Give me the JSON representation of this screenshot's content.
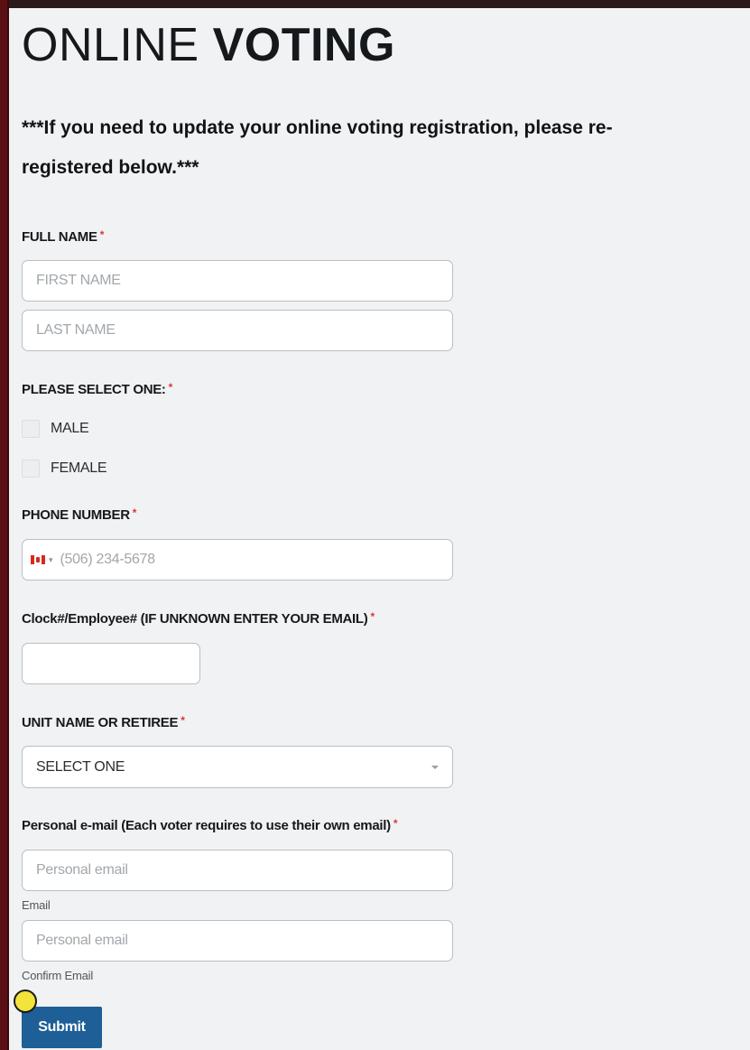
{
  "page": {
    "title_light": "ONLINE",
    "title_bold": "VOTING",
    "notice": "***If you need to update your online voting registration, please re-registered below.***"
  },
  "form": {
    "required_mark": "*",
    "full_name": {
      "label": "FULL NAME",
      "first_placeholder": "FIRST NAME",
      "last_placeholder": "LAST NAME"
    },
    "gender": {
      "label": "PLEASE SELECT ONE:",
      "options": [
        "MALE",
        "FEMALE"
      ]
    },
    "phone": {
      "label": "PHONE NUMBER",
      "country_flag": "canada-flag-icon",
      "placeholder": "(506) 234-5678"
    },
    "clock": {
      "label": "Clock#/Employee# (IF UNKNOWN ENTER YOUR EMAIL)",
      "value": ""
    },
    "unit": {
      "label": "UNIT NAME OR RETIREE",
      "selected": "SELECT ONE"
    },
    "email": {
      "label": "Personal e-mail (Each voter requires to use their own email)",
      "placeholder": "Personal email",
      "sublabel": "Email",
      "confirm_placeholder": "Personal email",
      "confirm_sublabel": "Confirm Email"
    },
    "submit_label": "Submit"
  },
  "colors": {
    "background": "#f0f2f3",
    "required": "#d9363e",
    "submit_button": "#1d5f96",
    "frame_left": "#5a1014",
    "cursor_highlight": "#f3e33a"
  }
}
